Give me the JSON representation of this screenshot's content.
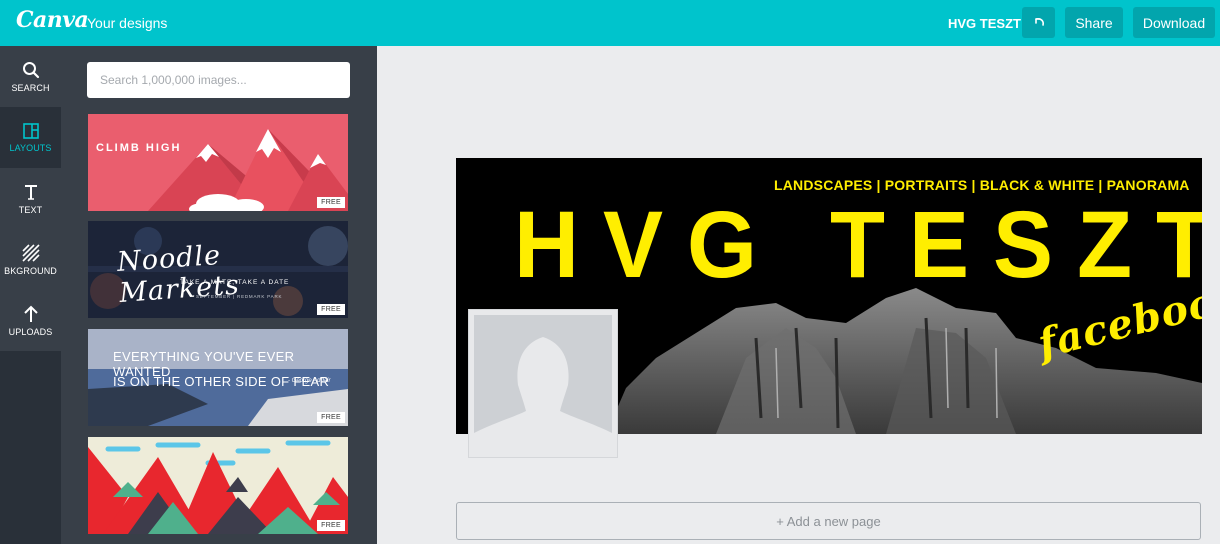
{
  "topbar": {
    "logo": "Canva",
    "your_designs": "Your designs",
    "design_title": "HVG TESZT",
    "share_label": "Share",
    "download_label": "Download",
    "bg_color": "#00c4cc",
    "button_color": "#02a5ad"
  },
  "leftnav": {
    "items": [
      {
        "label": "SEARCH",
        "icon": "search-icon"
      },
      {
        "label": "LAYOUTS",
        "icon": "layout-icon"
      },
      {
        "label": "TEXT",
        "icon": "text-icon"
      },
      {
        "label": "BKGROUND",
        "icon": "background-icon"
      },
      {
        "label": "UPLOADS",
        "icon": "upload-arrow-icon"
      }
    ],
    "active": "LAYOUTS"
  },
  "sidepanel": {
    "search_placeholder": "Search 1,000,000 images...",
    "free_badge": "FREE",
    "layouts": [
      {
        "text": "CLIMB HIGH"
      },
      {
        "text": "Noodle Markets",
        "sub": "TAKE A MATE, TAKE A DATE",
        "sub2": "SEPTEMBER | REDMARK PARK"
      },
      {
        "line1": "EVERYTHING YOU'VE EVER WANTED",
        "line2": "IS ON THE OTHER SIDE OF FEAR",
        "author": "- George Addair"
      },
      {
        "text": ""
      }
    ]
  },
  "canvas": {
    "tagline": "LANDSCAPES | PORTRAITS | BLACK & WHITE | PANORAMA",
    "title": "HVG TESZT",
    "script": "facebook",
    "accent_color": "#ffee00"
  },
  "add_page_label": "+ Add a new page"
}
